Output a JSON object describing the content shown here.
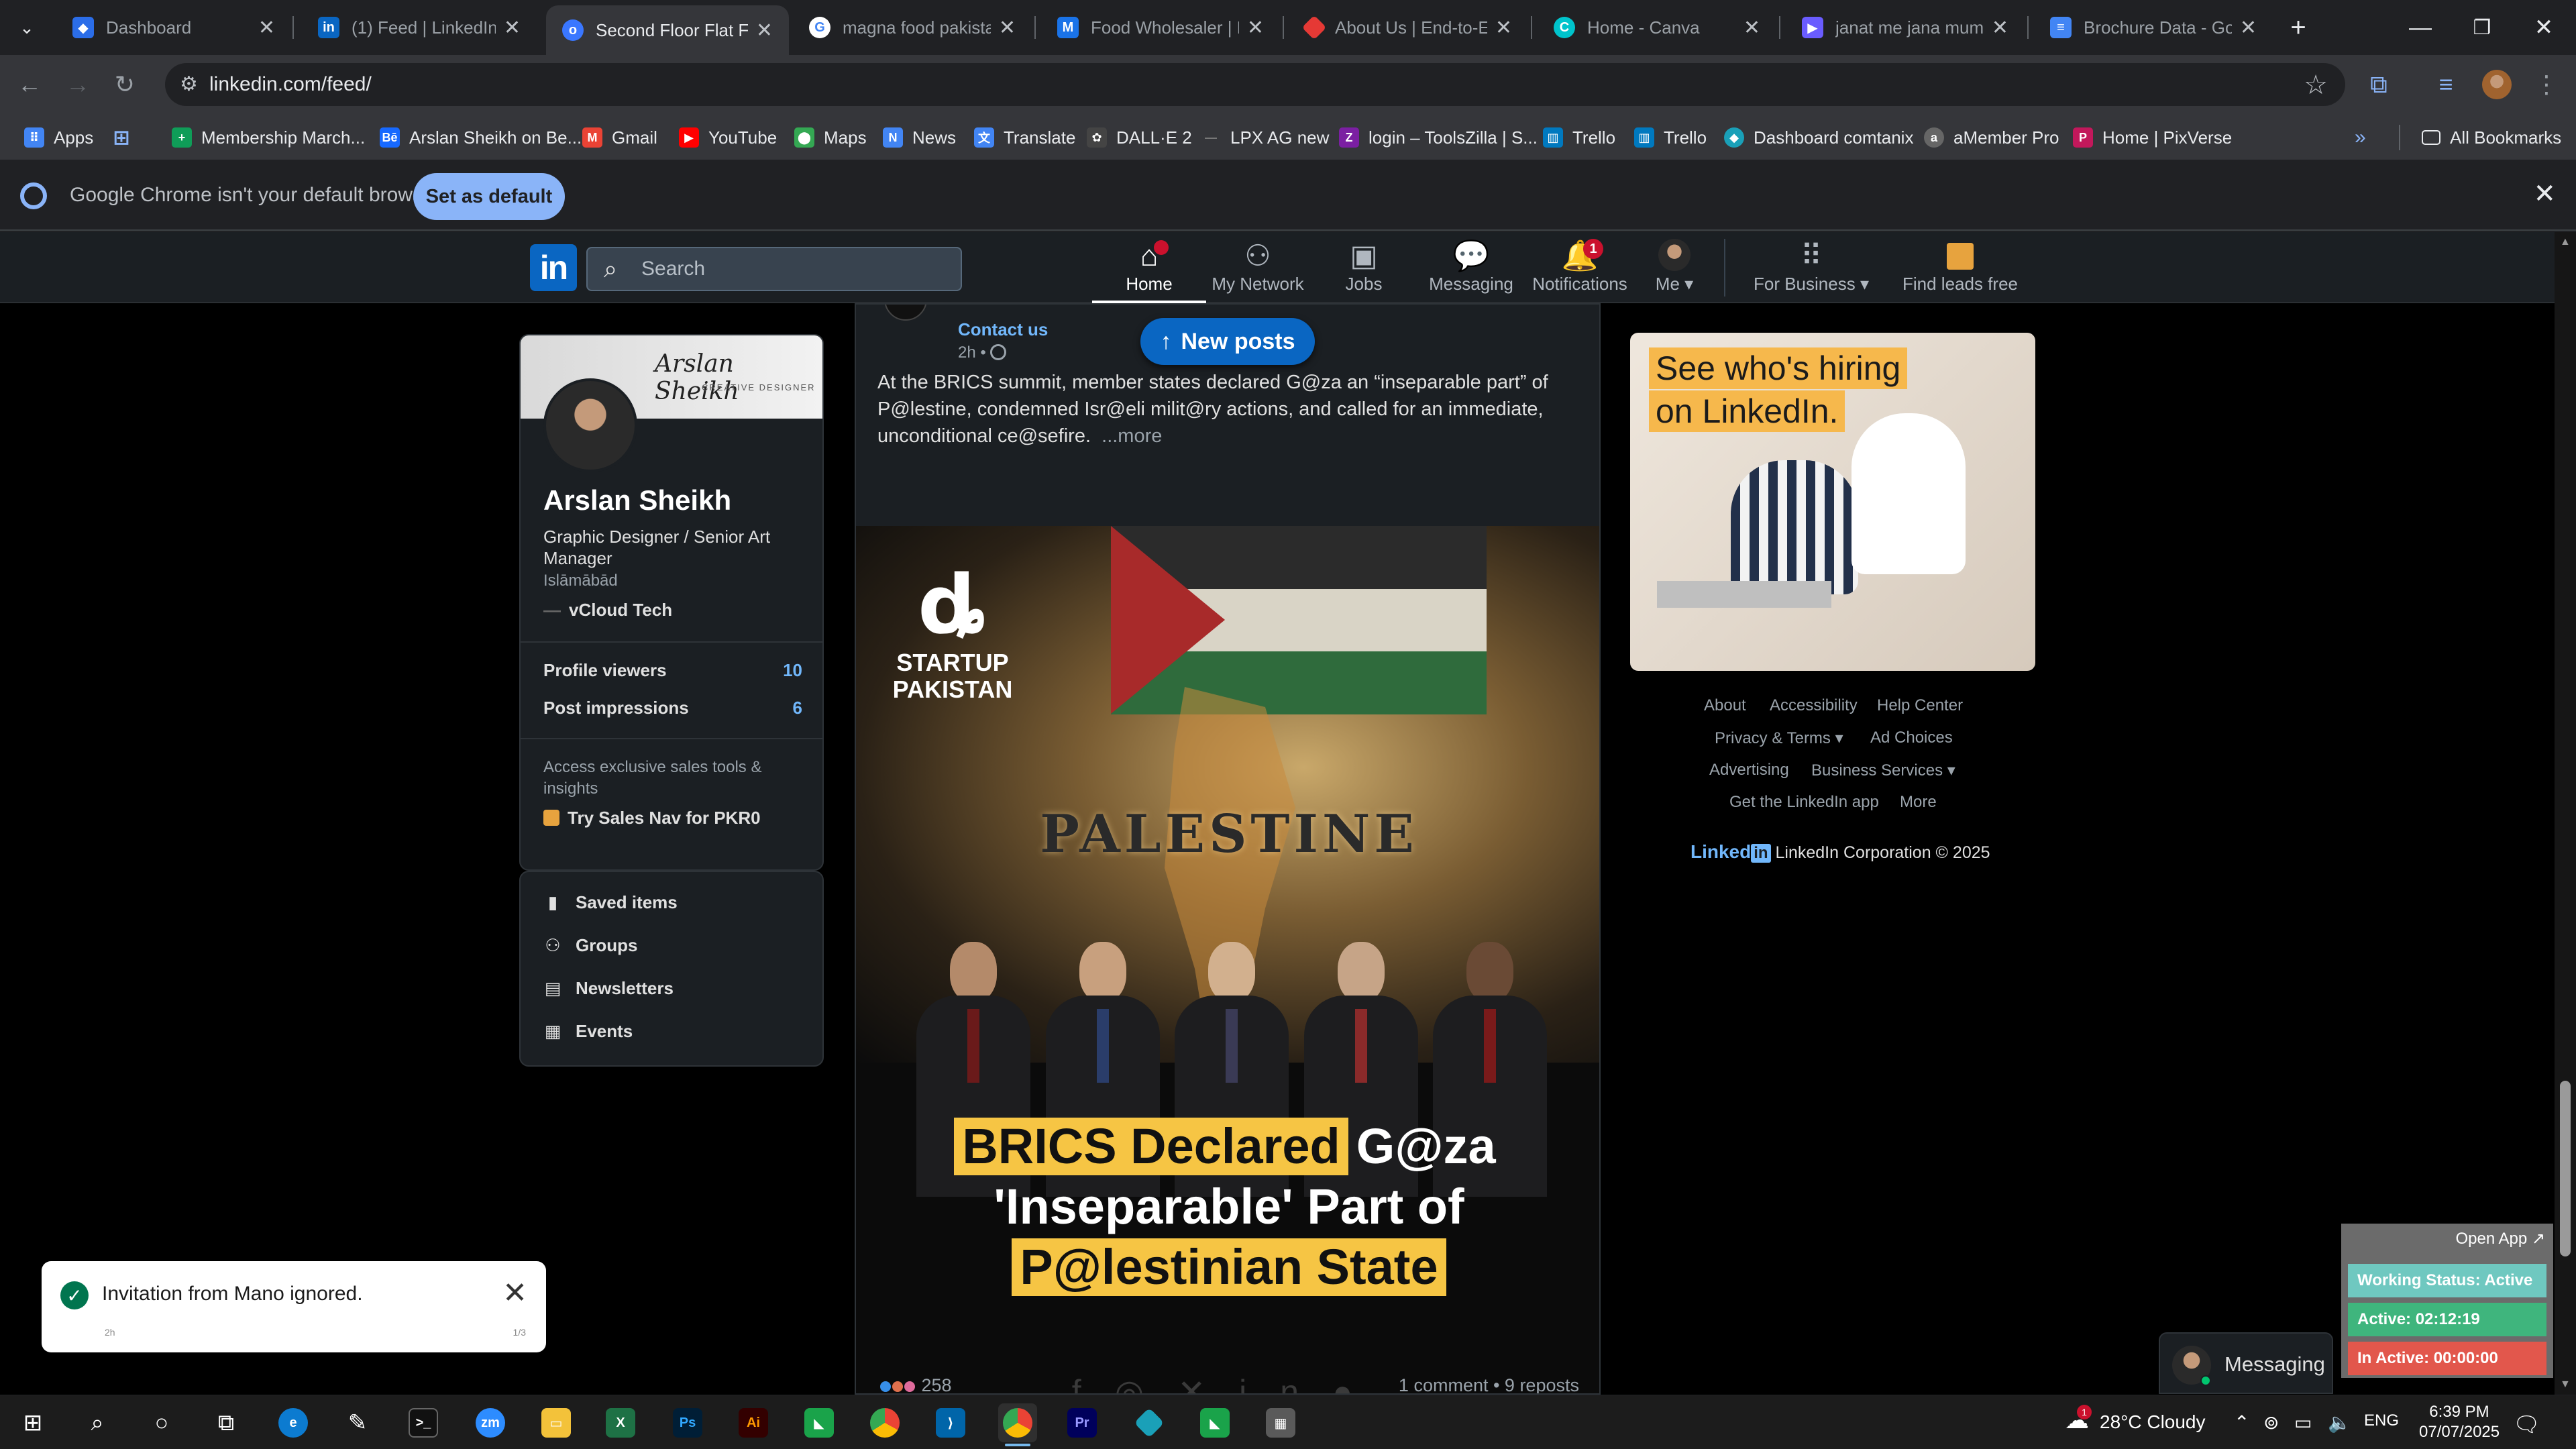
{
  "colors": {
    "accent": "#0a66c2",
    "link": "#71b7fb",
    "badge": "#cb112d"
  },
  "tabs": [
    {
      "title": "Dashboard",
      "icon": "dashboard-favicon-icon",
      "color": "#4f8ef7"
    },
    {
      "title": "(1) Feed | LinkedIn",
      "icon": "linkedin-favicon-icon",
      "color": "#0a66c2"
    },
    {
      "title": "Second Floor Flat For",
      "icon": "olx-favicon-icon",
      "color": "#3a77ff"
    },
    {
      "title": "magna food pakistan",
      "icon": "google-favicon-icon",
      "color": "#4285f4"
    },
    {
      "title": "Food Wholesaler | Ha",
      "icon": "m-favicon-icon",
      "color": "#1a73e8"
    },
    {
      "title": "About Us | End-to-En",
      "icon": "red-diamond-favicon-icon",
      "color": "#e53935"
    },
    {
      "title": "Home - Canva",
      "icon": "canva-favicon-icon",
      "color": "#00c4cc"
    },
    {
      "title": "janat me jana mumki",
      "icon": "video-favicon-icon",
      "color": "#6a5cff"
    },
    {
      "title": "Brochure Data - Goo",
      "icon": "docs-favicon-icon",
      "color": "#4285f4"
    }
  ],
  "address": {
    "url": "linkedin.com/feed/"
  },
  "bookmarks": [
    {
      "label": "Apps",
      "color": "#4285f4"
    },
    {
      "label": "",
      "color": "#1a73e8"
    },
    {
      "label": "Membership March...",
      "color": "#0f9d58"
    },
    {
      "label": "Arslan Sheikh on Be...",
      "color": "#1769ff"
    },
    {
      "label": "Gmail",
      "color": "#ea4335"
    },
    {
      "label": "YouTube",
      "color": "#ff0000"
    },
    {
      "label": "Maps",
      "color": "#34a853"
    },
    {
      "label": "News",
      "color": "#4285f4"
    },
    {
      "label": "Translate",
      "color": "#4285f4"
    },
    {
      "label": "DALL·E 2",
      "color": "#444444"
    },
    {
      "label": "LPX AG new",
      "color": "#555555"
    },
    {
      "label": "login – ToolsZilla | S...",
      "color": "#7b1fa2"
    },
    {
      "label": "Trello",
      "color": "#0079bf"
    },
    {
      "label": "Trello",
      "color": "#0079bf"
    },
    {
      "label": "Dashboard comtanix",
      "color": "#1aa0b8"
    },
    {
      "label": "aMember Pro",
      "color": "#666666"
    },
    {
      "label": "Home | PixVerse",
      "color": "#c2185b"
    }
  ],
  "all_bookmarks": "All Bookmarks",
  "infobar": {
    "message": "Google Chrome isn't your default browser",
    "button": "Set as default"
  },
  "linkedin": {
    "search_placeholder": "Search",
    "nav": [
      {
        "label": "Home",
        "badge": ""
      },
      {
        "label": "My Network",
        "badge": ""
      },
      {
        "label": "Jobs",
        "badge": ""
      },
      {
        "label": "Messaging",
        "badge": ""
      },
      {
        "label": "Notifications",
        "badge": "1"
      },
      {
        "label": "Me",
        "badge": ""
      },
      {
        "label": "For Business",
        "badge": ""
      },
      {
        "label": "Find leads free",
        "badge": ""
      }
    ],
    "profile": {
      "banner_signature": "Arslan Sheikh",
      "banner_sub": "CREATIVE DESIGNER",
      "name": "Arslan Sheikh",
      "headline": "Graphic Designer / Senior Art Manager",
      "location": "Islāmābād",
      "company": "vCloud Tech",
      "stats": [
        {
          "label": "Profile viewers",
          "value": "10"
        },
        {
          "label": "Post impressions",
          "value": "6"
        }
      ],
      "premium_text": "Access exclusive sales tools & insights",
      "premium_link": "Try Sales Nav for PKR0"
    },
    "links": [
      {
        "label": "Saved items",
        "icon": "bookmark-icon"
      },
      {
        "label": "Groups",
        "icon": "groups-icon"
      },
      {
        "label": "Newsletters",
        "icon": "newsletter-icon"
      },
      {
        "label": "Events",
        "icon": "calendar-icon"
      }
    ],
    "post": {
      "contact": "Contact us",
      "time": "2h •",
      "body": "At the BRICS summit, member states declared G@za an “inseparable part” of P@lestine, condemned Isr@eli milit@ry actions, and called for an immediate, unconditional ce@sefire.",
      "more": "...more",
      "image": {
        "logo_line1": "STARTUP",
        "logo_line2": "PAKISTAN",
        "banner": "PALESTINE",
        "headline_1a": "BRICS Declared",
        "headline_1b": "G@za",
        "headline_2": "'Inseparable' Part of",
        "headline_3": "P@lestinian State"
      },
      "reactions": "258",
      "engagement": "1 comment • 9 reposts"
    },
    "new_posts": "New posts",
    "ad": {
      "line1": "See who's hiring",
      "line2": "on LinkedIn."
    },
    "footer": {
      "about": "About",
      "accessibility": "Accessibility",
      "help": "Help Center",
      "privacy": "Privacy & Terms",
      "adchoices": "Ad Choices",
      "advertising": "Advertising",
      "business": "Business Services",
      "getapp": "Get the LinkedIn app",
      "more": "More",
      "logo_text": "Linked",
      "logo_in": "in",
      "copyright": "LinkedIn Corporation © 2025"
    },
    "messaging": "Messaging"
  },
  "toast": {
    "text": "Invitation from Mano ignored.",
    "left_small": "2h",
    "right_small": "1/3"
  },
  "tracker": {
    "open": "Open App ↗",
    "working": "Working Status: Active",
    "active": "Active: 02:12:19",
    "inactive": "In Active: 00:00:00"
  },
  "taskbar": {
    "weather_badge": "1",
    "weather": "28°C  Cloudy",
    "lang": "ENG",
    "time": "6:39 PM",
    "date": "07/07/2025"
  }
}
